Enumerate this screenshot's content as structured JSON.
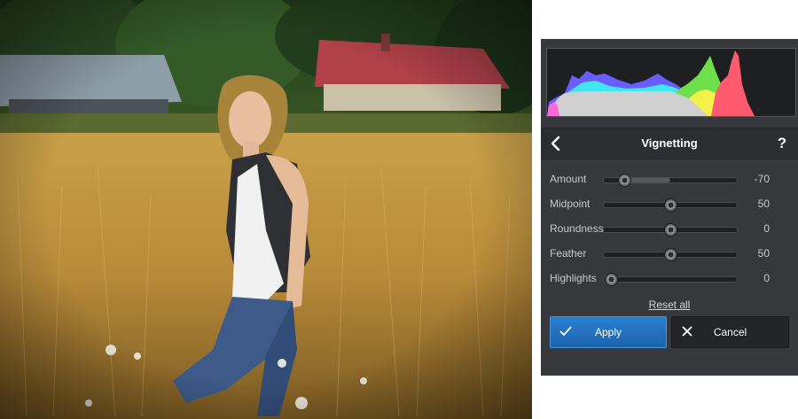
{
  "panel": {
    "title": "Vignetting",
    "help_label": "?",
    "back_icon": "chevron-left-icon",
    "sliders": [
      {
        "label": "Amount",
        "value": "-70",
        "position": 0.15,
        "fill_to": 0.5
      },
      {
        "label": "Midpoint",
        "value": "50",
        "position": 0.5,
        "fill_to": 0
      },
      {
        "label": "Roundness",
        "value": "0",
        "position": 0.5,
        "fill_to": 0
      },
      {
        "label": "Feather",
        "value": "50",
        "position": 0.5,
        "fill_to": 0
      },
      {
        "label": "Highlights",
        "value": "0",
        "position": 0.05,
        "fill_to": 0
      }
    ],
    "reset_label": "Reset all",
    "apply_label": "Apply",
    "cancel_label": "Cancel",
    "apply_icon": "checkmark-icon",
    "cancel_icon": "close-icon"
  },
  "colors": {
    "panel_bg": "#36383b",
    "header_bg": "#2b2d30",
    "accent": "#1f6fbf",
    "histogram_red": "#ff5a6e",
    "histogram_green": "#6ee04a",
    "histogram_blue": "#6a5cff",
    "histogram_yellow": "#f2f24a",
    "histogram_cyan": "#40e6f0",
    "histogram_gray": "#d0d0d0"
  }
}
